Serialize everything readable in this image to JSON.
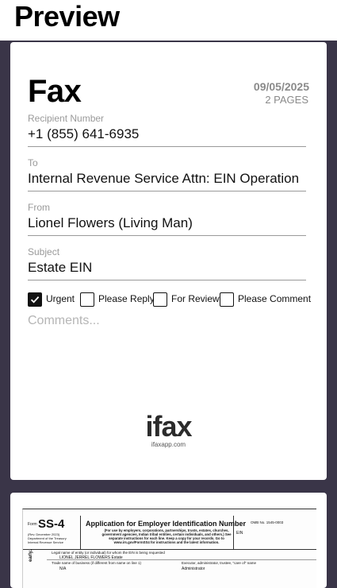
{
  "header": {
    "title": "Preview"
  },
  "cover": {
    "title": "Fax",
    "date": "09/05/2025",
    "pages": "2 PAGES",
    "recipient": {
      "label": "Recipient Number",
      "value": "+1 (855) 641-6935"
    },
    "to": {
      "label": "To",
      "value": "Internal Revenue Service Attn: EIN Operation"
    },
    "from": {
      "label": "From",
      "value": "Lionel Flowers (Living Man)"
    },
    "subject": {
      "label": "Subject",
      "value": "Estate EIN"
    },
    "checkboxes": [
      {
        "label": "Urgent",
        "checked": true
      },
      {
        "label": "Please Reply",
        "checked": false
      },
      {
        "label": "For Review",
        "checked": false
      },
      {
        "label": "Please Comment",
        "checked": false
      }
    ],
    "comments_placeholder": "Comments...",
    "logo": {
      "word": "ifax",
      "url": "ifaxapp.com"
    }
  },
  "page2": {
    "form_prefix": "Form",
    "form_name": "SS-4",
    "rev": "(Rev. December 2023)",
    "dept": "Department of the Treasury Internal Revenue Service",
    "title": "Application for Employer Identification Number",
    "subtitle": "(For use by employers, corporations, partnerships, trusts, estates, churches, government agencies, Indian tribal entities, certain individuals, and others.) See separate instructions for each line. Keep a copy for your records. Go to www.irs.gov/FormSS4 for instructions and the latest information.",
    "omb": "OMB No. 1545-0003",
    "ein": "EIN",
    "line1_label": "Legal name of entity (or individual) for whom the EIN is being requested",
    "line1_value": "LIONEL JERREL FLOWERS Estate",
    "line2_label": "Trade name of business (if different from name on line 1)",
    "line2_value": "N/A",
    "line3_label": "Executor, administrator, trustee, \"care of\" name",
    "line3_value": "Administrator",
    "side": "early."
  }
}
